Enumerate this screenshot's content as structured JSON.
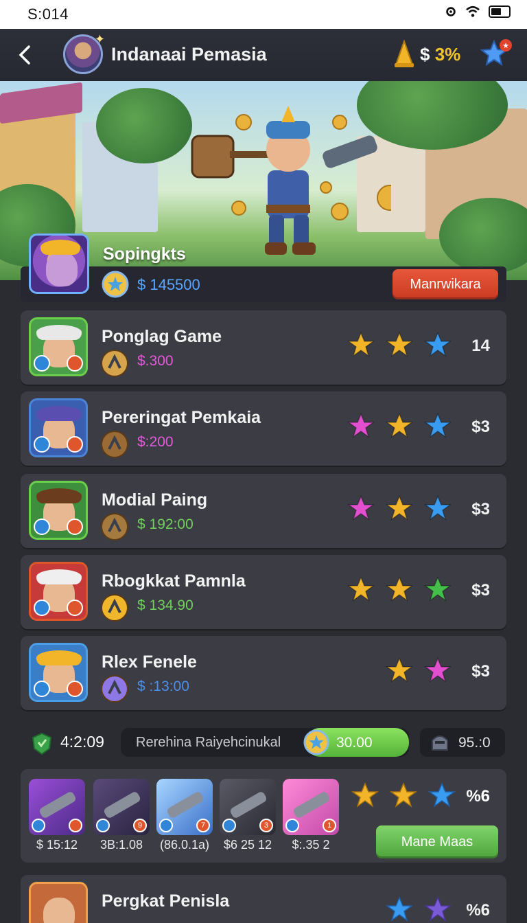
{
  "status": {
    "time": "S:014"
  },
  "header": {
    "title": "Indanaai Pemasia",
    "currency_symbol": "$",
    "currency_value": "3%"
  },
  "featured": {
    "name": "Sopingkts",
    "amount": "$ 145500",
    "button": "Manrwikara"
  },
  "rows": [
    {
      "name": "Ponglag Game",
      "amount": "$.300",
      "amount_color": "#e25ad9",
      "value": "14",
      "stars": [
        "gold",
        "gold",
        "blue"
      ]
    },
    {
      "name": "Pereringat Pemkaia",
      "amount": "$:200",
      "amount_color": "#e25ad9",
      "value": "$3",
      "stars": [
        "pink",
        "gold",
        "blue"
      ]
    },
    {
      "name": "Modial Paing",
      "amount": "$ 192:00",
      "amount_color": "#6fd15a",
      "value": "$3",
      "stars": [
        "pink",
        "gold",
        "blue"
      ]
    },
    {
      "name": "Rbogkkat Pamnla",
      "amount": "$ 134.90",
      "amount_color": "#6fd15a",
      "value": "$3",
      "stars": [
        "gold",
        "gold",
        "green"
      ]
    },
    {
      "name": "Rlex Fenele",
      "amount": "$ :13:00",
      "amount_color": "#4d8fe8",
      "value": "$3",
      "stars": [
        "gold",
        "pink"
      ]
    }
  ],
  "timer": {
    "time": "4:2:09",
    "label": "Rerehina Raiyehcinukal",
    "progress_value": "30.00",
    "stat": "95.:0"
  },
  "items_panel": {
    "items": [
      {
        "caption": "$ 15:12"
      },
      {
        "caption": "3B:1.08"
      },
      {
        "caption": "(86.0.1a)"
      },
      {
        "caption": "$6 25 12"
      },
      {
        "caption": "$:.35 2"
      }
    ],
    "item_badges": [
      "",
      "9",
      "7",
      "3",
      "1"
    ],
    "value": "%6",
    "button": "Mane Maas"
  },
  "last_row": {
    "name": "Pergkat Penisla",
    "value": "%6"
  },
  "colors": {
    "gold": "#f2b52a",
    "blue": "#3a9cf0",
    "pink": "#e24fcf",
    "green": "#44c04a",
    "accent_red": "#d9472c"
  }
}
